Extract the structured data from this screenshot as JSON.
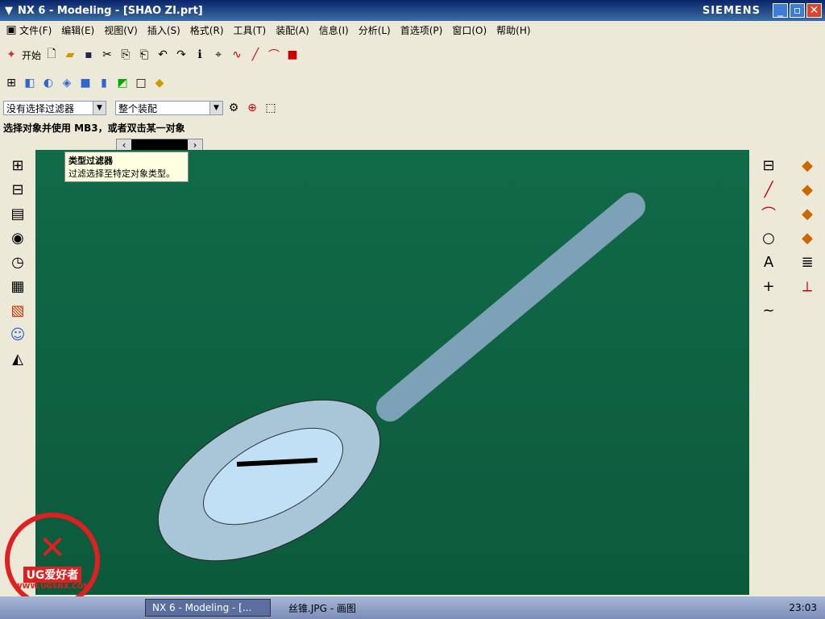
{
  "title": "NX 6 - Modeling - [SHAO ZI.prt]",
  "brand": "SIEMENS",
  "menu": [
    "文件(F)",
    "编辑(E)",
    "视图(V)",
    "插入(S)",
    "格式(R)",
    "工具(T)",
    "装配(A)",
    "信息(I)",
    "分析(L)",
    "首选项(P)",
    "窗口(O)",
    "帮助(H)"
  ],
  "start": "开始",
  "filter": "没有选择过滤器",
  "scope": "整个装配",
  "cue": "选择对象并使用 MB3，或者双击某一对象",
  "tip": {
    "title": "类型过滤器",
    "body": "过滤选择至特定对象类型。"
  },
  "logo": {
    "text": "UG爱好者",
    "url": "WWW.UGSNX.COM"
  },
  "task": {
    "a": "NX 6 - Modeling - [...",
    "b": "丝锥.JPG - 画图",
    "time": "23:03"
  },
  "colors": {
    "viewport": "#106a48",
    "title": "#0a246a"
  },
  "right_icons": [
    "A",
    "+",
    "~"
  ]
}
